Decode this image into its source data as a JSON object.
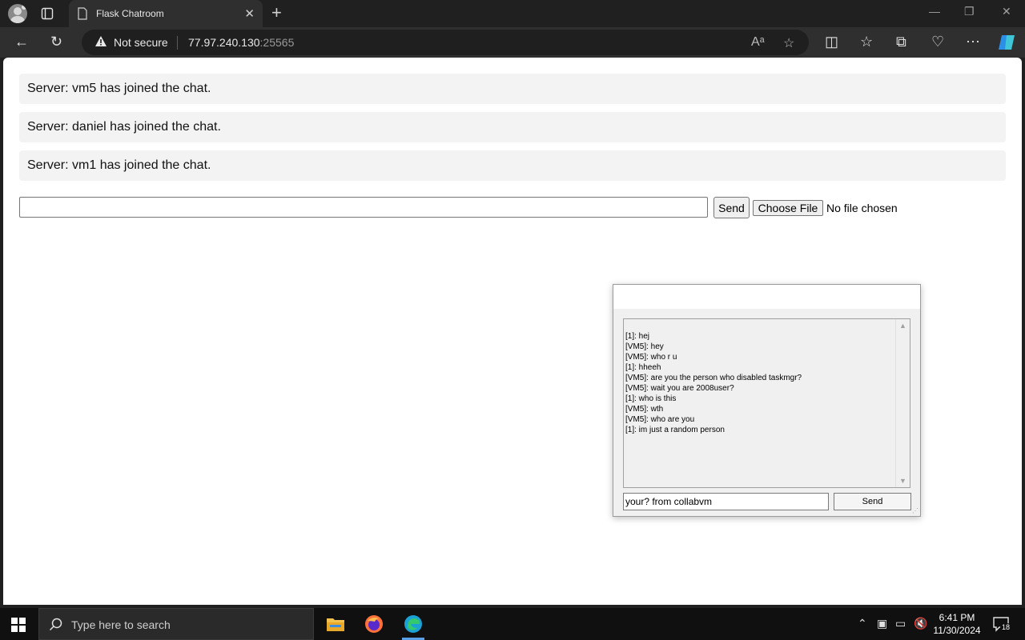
{
  "browser": {
    "tab_title": "Flask Chatroom",
    "security_label": "Not secure",
    "url_host": "77.97.240.130",
    "url_port": ":25565"
  },
  "chatroom": {
    "messages": [
      "Server: vm5 has joined the chat.",
      "Server: daniel has joined the chat.",
      "Server: vm1 has joined the chat."
    ],
    "input_value": "",
    "send_label": "Send",
    "choose_file_label": "Choose File",
    "no_file_label": "No file chosen"
  },
  "popup": {
    "log_lines": [
      "[1]: hej",
      "[VM5]: hey",
      "[VM5]: who r u",
      "[1]: hheeh",
      "[VM5]: are you the person who disabled taskmgr?",
      "[VM5]: wait you are 2008user?",
      "[1]: who is this",
      "[VM5]: wth",
      "[VM5]: who are you",
      "[1]: im just a random person"
    ],
    "input_value": "your? from collabvm",
    "send_label": "Send"
  },
  "taskbar": {
    "search_placeholder": "Type here to search",
    "time": "6:41 PM",
    "date": "11/30/2024",
    "notification_count": "18",
    "apps": [
      "file-explorer-icon",
      "firefox-icon",
      "edge-icon"
    ]
  },
  "colors": {
    "browser_chrome": "#202020",
    "message_bg": "#f3f3f3",
    "taskbar_bg": "#101010"
  }
}
